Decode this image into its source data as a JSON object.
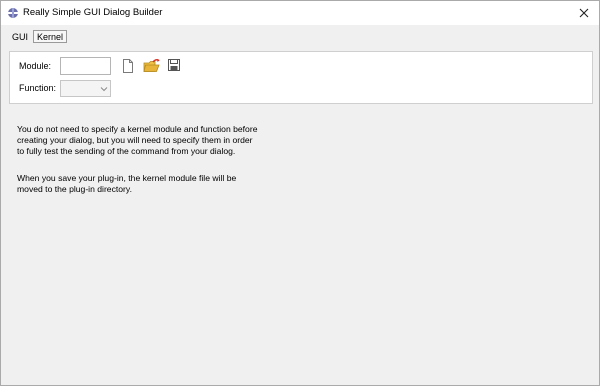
{
  "window": {
    "title": "Really Simple GUI Dialog Builder",
    "app_icon": "app-icon",
    "close_glyph": "✕"
  },
  "tabs": [
    {
      "label": "GUI",
      "selected": false
    },
    {
      "label": "Kernel",
      "selected": true
    }
  ],
  "kernel": {
    "module_label": "Module:",
    "module_value": "",
    "function_label": "Function:",
    "function_value": "",
    "icons": [
      "new-file-icon",
      "open-folder-icon",
      "save-disk-icon"
    ]
  },
  "info": {
    "paragraph1": "You do not need to specify a kernel module and function before\ncreating your dialog, but you will need to specify them in order\nto fully test the sending of the command from your dialog.",
    "paragraph2": "When you save your plug-in, the kernel module file will be\nmoved to the plug-in directory."
  },
  "colors": {
    "panel_bg": "#f0f0f0",
    "group_bg": "#ffffff",
    "folder_yellow": "#e8b43a",
    "folder_red_arrow": "#d9362b"
  }
}
